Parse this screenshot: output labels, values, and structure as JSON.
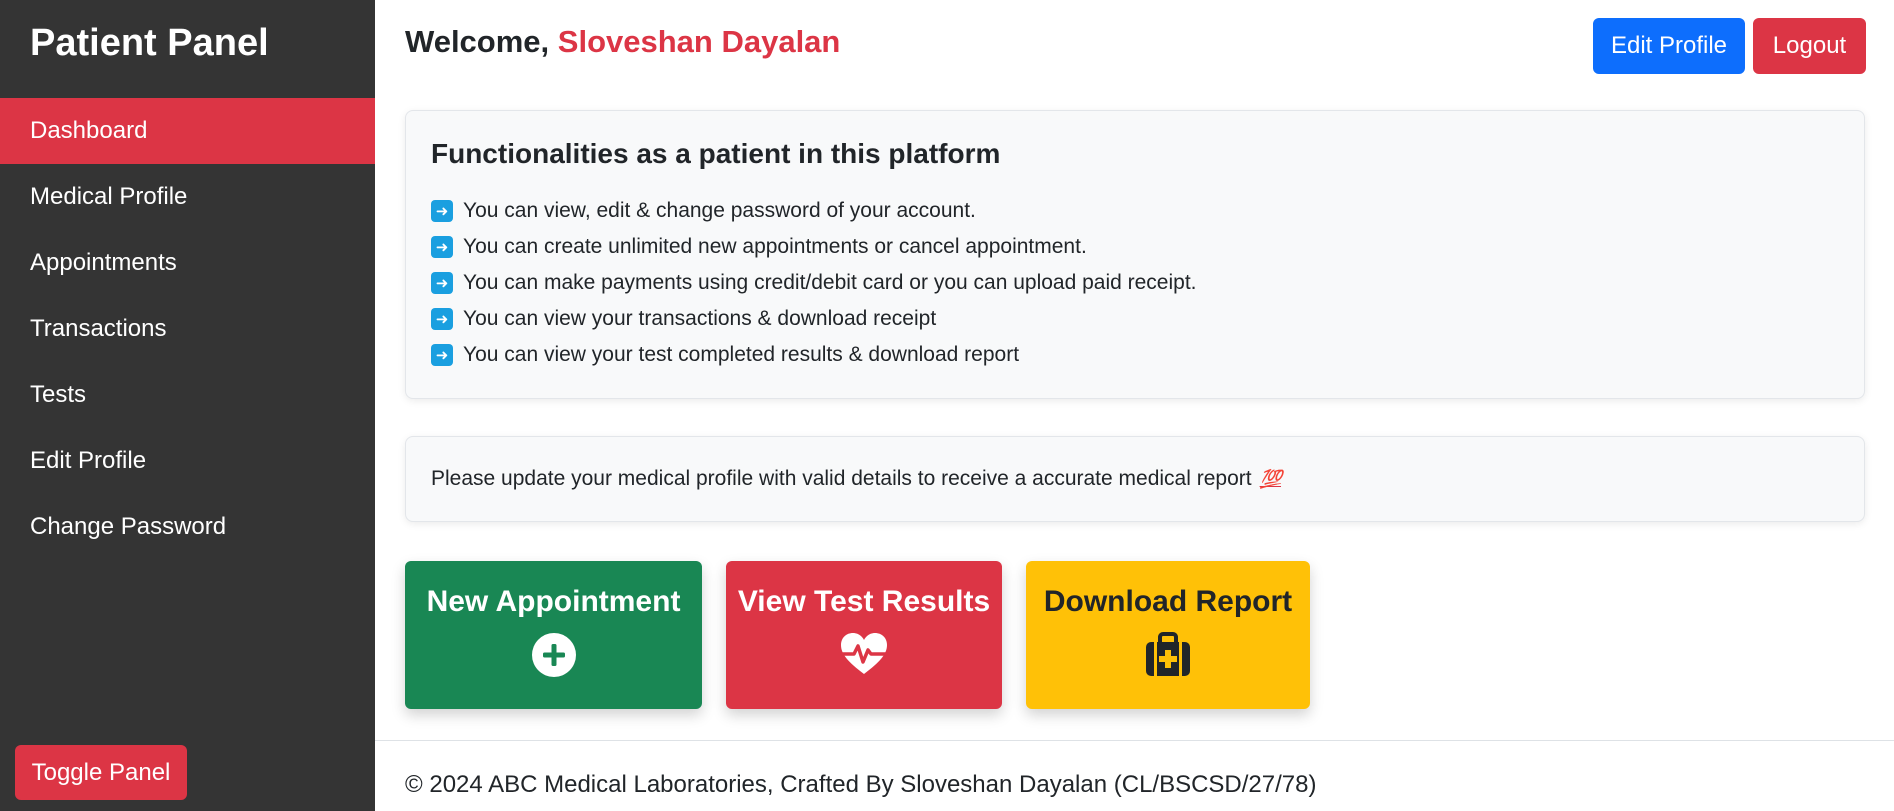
{
  "sidebar": {
    "title": "Patient Panel",
    "items": [
      {
        "label": "Dashboard"
      },
      {
        "label": "Medical Profile"
      },
      {
        "label": "Appointments"
      },
      {
        "label": "Transactions"
      },
      {
        "label": "Tests"
      },
      {
        "label": "Edit Profile"
      },
      {
        "label": "Change Password"
      }
    ],
    "active_item": "Dashboard",
    "toggle_label": "Toggle Panel"
  },
  "header": {
    "welcome_prefix": "Welcome,",
    "user_name": "Sloveshan Dayalan",
    "edit_profile_label": "Edit Profile",
    "logout_label": "Logout"
  },
  "functionalities": {
    "title": "Functionalities as a patient in this platform",
    "item_icon": "arrow-right-icon",
    "items": [
      "You can view, edit & change password of your account.",
      "You can create unlimited new appointments or cancel appointment.",
      "You can make payments using credit/debit card or you can upload paid receipt.",
      "You can view your transactions & download receipt",
      "You can view your test completed results & download report"
    ]
  },
  "notice": {
    "text": "Please update your medical profile with valid details to receive a accurate medical report",
    "emoji": "💯",
    "icon": "hundred-points-icon"
  },
  "tiles": {
    "new_appointment": {
      "label": "New Appointment",
      "icon": "plus-circle-icon",
      "color": "#198754"
    },
    "view_results": {
      "label": "View Test Results",
      "icon": "heart-pulse-icon",
      "color": "#dc3545"
    },
    "download_report": {
      "label": "Download Report",
      "icon": "medical-bag-icon",
      "color": "#ffc107"
    }
  },
  "footer": {
    "text": "© 2024 ABC Medical Laboratories, Crafted By Sloveshan Dayalan (CL/BSCSD/27/78)"
  },
  "colors": {
    "sidebar_bg": "#343434",
    "accent_red": "#dc3545",
    "primary_blue": "#0d6efd",
    "success_green": "#198754",
    "warning_yellow": "#ffc107",
    "card_bg": "#f8f9fa"
  }
}
